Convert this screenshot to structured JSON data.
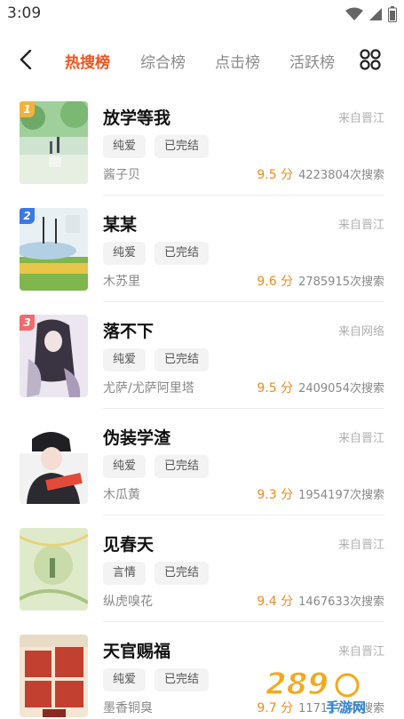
{
  "status_bar": {
    "time": "3:09"
  },
  "nav": {
    "tabs": [
      {
        "label": "热搜榜",
        "active": true
      },
      {
        "label": "综合榜",
        "active": false
      },
      {
        "label": "点击榜",
        "active": false
      },
      {
        "label": "活跃榜",
        "active": false
      }
    ]
  },
  "books": [
    {
      "rank": "1",
      "title": "放学等我",
      "source": "来自晋江",
      "tags": [
        "纯爱",
        "已完结"
      ],
      "author": "酱子贝",
      "score": "9.5 分",
      "searches": "4223804次搜索"
    },
    {
      "rank": "2",
      "title": "某某",
      "source": "来自晋江",
      "tags": [
        "纯爱",
        "已完结"
      ],
      "author": "木苏里",
      "score": "9.6 分",
      "searches": "2785915次搜索"
    },
    {
      "rank": "3",
      "title": "落不下",
      "source": "来自网络",
      "tags": [
        "纯爱",
        "已完结"
      ],
      "author": "尤萨/尤萨阿里塔",
      "score": "9.5 分",
      "searches": "2409054次搜索"
    },
    {
      "rank": "",
      "title": "伪装学渣",
      "source": "来自晋江",
      "tags": [
        "纯爱",
        "已完结"
      ],
      "author": "木瓜黄",
      "score": "9.3 分",
      "searches": "1954197次搜索"
    },
    {
      "rank": "",
      "title": "见春天",
      "source": "来自晋江",
      "tags": [
        "言情",
        "已完结"
      ],
      "author": "纵虎嗅花",
      "score": "9.4 分",
      "searches": "1467633次搜索"
    },
    {
      "rank": "",
      "title": "天官赐福",
      "source": "来自晋江",
      "tags": [
        "纯爱",
        "已完结"
      ],
      "author": "墨香铜臭",
      "score": "9.7 分",
      "searches": "1171170次搜索"
    }
  ],
  "colors": {
    "accent": "#f3541e",
    "score": "#f08a1c",
    "rank_1": "#f2b33c",
    "rank_2": "#3a78e6",
    "rank_3": "#f06b6b"
  },
  "watermark": {
    "text": "289",
    "subtext": "手游网"
  }
}
